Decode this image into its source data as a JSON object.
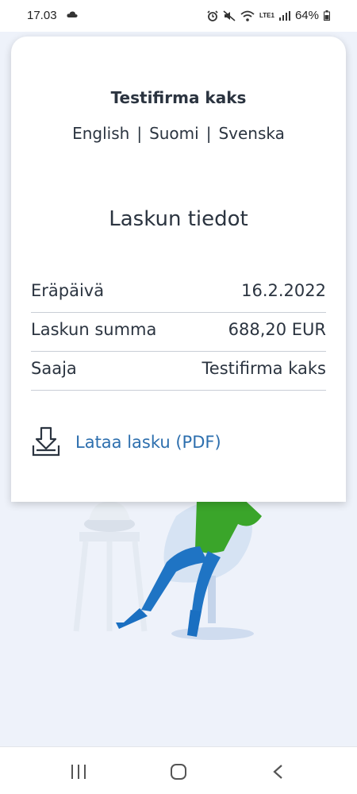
{
  "status_bar": {
    "time": "17.03",
    "network": "LTE1",
    "battery": "64%"
  },
  "card": {
    "company_name": "Testifirma kaks",
    "languages": [
      "English",
      "Suomi",
      "Svenska"
    ],
    "separator": "|",
    "section_title": "Laskun tiedot",
    "details": [
      {
        "label": "Eräpäivä",
        "value": "16.2.2022"
      },
      {
        "label": "Laskun summa",
        "value": "688,20 EUR"
      },
      {
        "label": "Saaja",
        "value": "Testifirma kaks"
      }
    ],
    "download_label": "Lataa lasku (PDF)",
    "download_icon": "download-tray-icon"
  },
  "nav_bar": {
    "icons": [
      "recent-apps-icon",
      "home-icon",
      "back-icon"
    ]
  },
  "colors": {
    "link": "#2d6fae",
    "text": "#2b3440",
    "background": "#eef2fa",
    "accent_green": "#3aa52a",
    "accent_blue": "#1f74c4"
  }
}
